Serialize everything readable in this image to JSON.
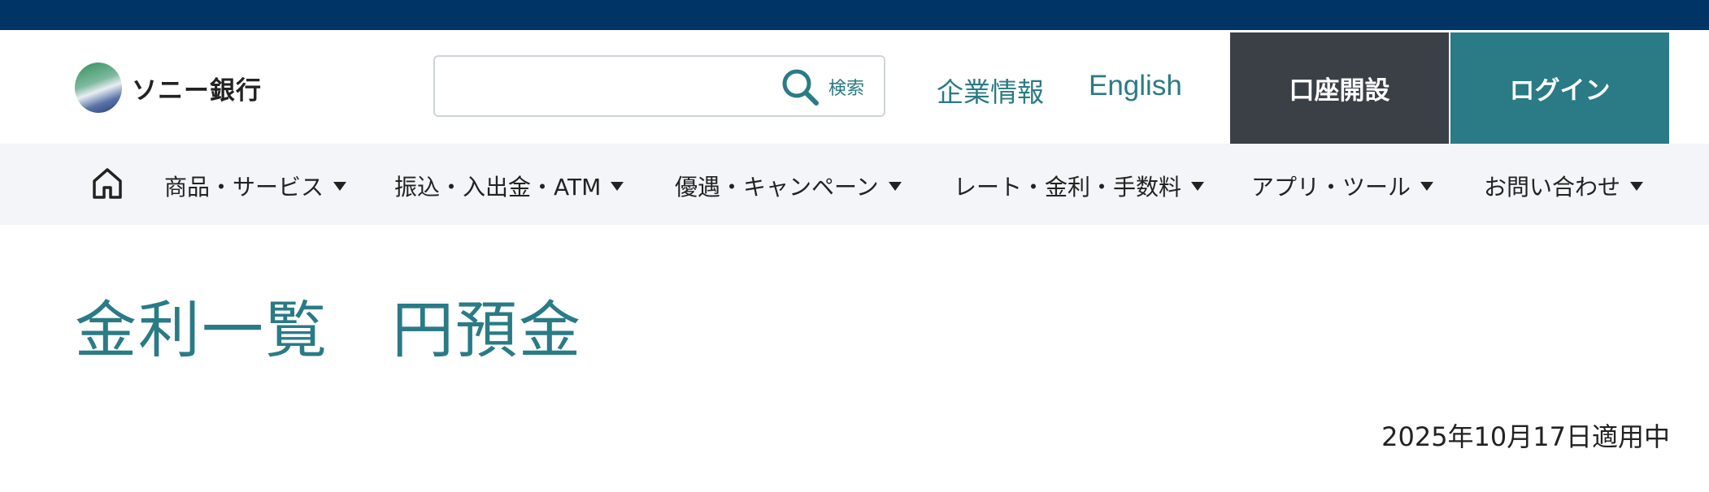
{
  "header": {
    "logo_text": "ソニー銀行",
    "search": {
      "placeholder": "",
      "value": "",
      "button_label": "検索"
    },
    "links": {
      "corporate": "企業情報",
      "english": "English"
    },
    "buttons": {
      "open_account": "口座開設",
      "login": "ログイン"
    }
  },
  "nav": {
    "items": [
      {
        "label": "商品・サービス"
      },
      {
        "label": "振込・入出金・ATM"
      },
      {
        "label": "優遇・キャンペーン"
      },
      {
        "label": "レート・金利・手数料"
      },
      {
        "label": "アプリ・ツール"
      },
      {
        "label": "お問い合わせ"
      }
    ]
  },
  "main": {
    "title": "金利一覧　円預金",
    "applied_date": "2025年10月17日適用中"
  },
  "colors": {
    "top_bar": "#003366",
    "accent": "#2a7b86",
    "dark_button": "#3b3f46",
    "nav_bg": "#f4f5f8"
  }
}
